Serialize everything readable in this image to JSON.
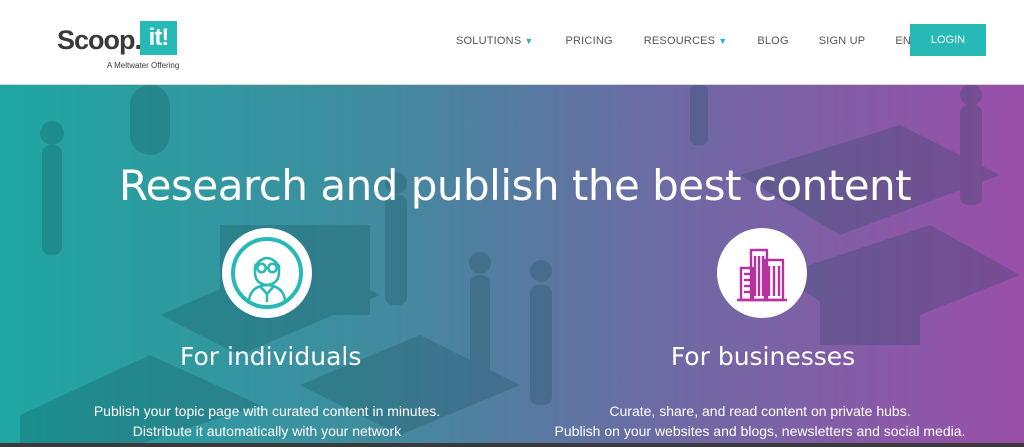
{
  "header": {
    "logo": {
      "word": "Scoop.",
      "badge": "it!",
      "tagline": "A Meltwater Offering"
    },
    "nav": {
      "solutions": "SOLUTIONS",
      "pricing": "PRICING",
      "resources": "RESOURCES",
      "blog": "BLOG",
      "signup": "SIGN UP",
      "language": "EN"
    },
    "login_label": "LOGIN"
  },
  "hero": {
    "title": "Research and publish the best content",
    "individuals": {
      "icon": "person-with-glasses-icon",
      "heading": "For individuals",
      "line1": "Publish your topic page with curated content in minutes.",
      "line2": "Distribute it automatically with your network"
    },
    "businesses": {
      "icon": "office-buildings-icon",
      "heading": "For businesses",
      "line1": "Curate, share, and read content on private hubs.",
      "line2": "Publish on your websites and blogs, newsletters and social media."
    }
  },
  "colors": {
    "brand_teal": "#27b9b5",
    "icon_magenta": "#b5329f",
    "hero_gradient_start": "#1fa7a3",
    "hero_gradient_end": "#9a4fa9"
  }
}
